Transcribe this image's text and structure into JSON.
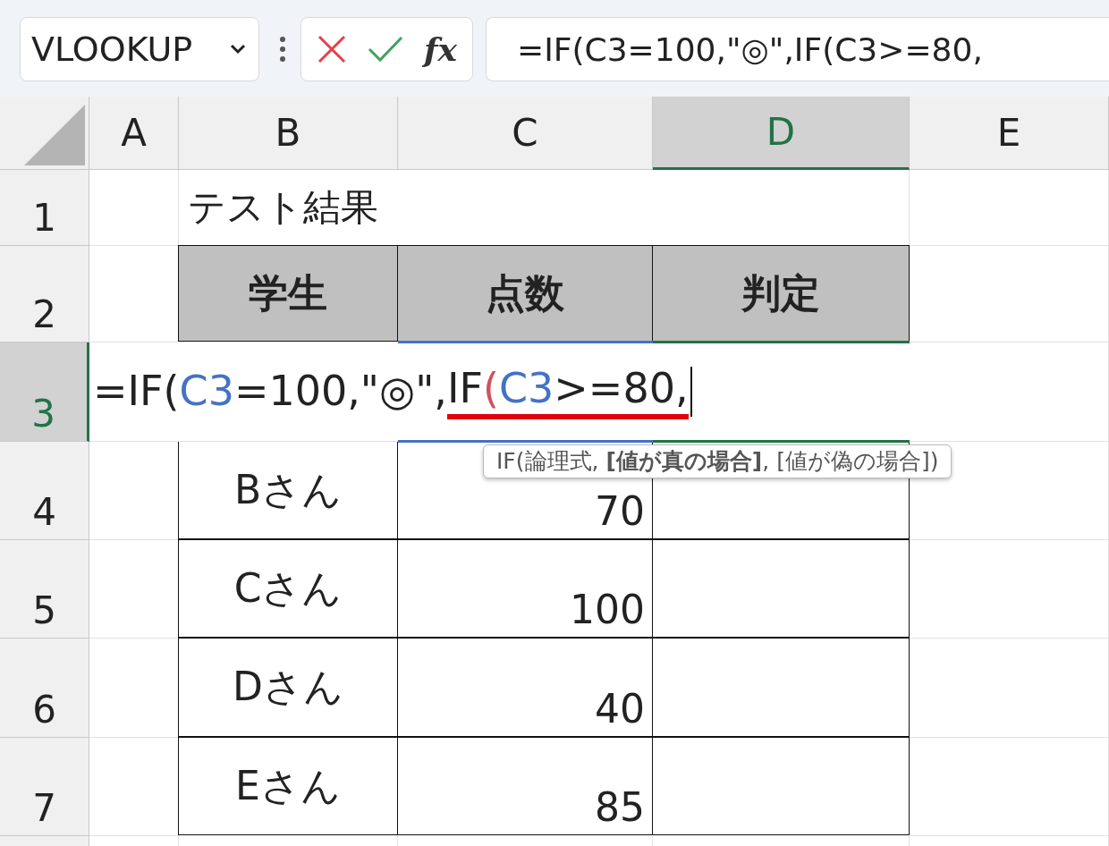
{
  "name_box": {
    "value": "VLOOKUP"
  },
  "formula_bar": {
    "fx_label": "fx",
    "value": "=IF(C3=100,\"◎\",IF(C3>=80,"
  },
  "columns": [
    {
      "label": "A",
      "selected": false
    },
    {
      "label": "B",
      "selected": false
    },
    {
      "label": "C",
      "selected": false
    },
    {
      "label": "D",
      "selected": true
    },
    {
      "label": "E",
      "selected": false
    }
  ],
  "rows": [
    {
      "label": "1",
      "selected": false,
      "kind": "title",
      "text": "テスト結果"
    },
    {
      "label": "2",
      "selected": false,
      "kind": "header",
      "cells": [
        "学生",
        "点数",
        "判定"
      ]
    },
    {
      "label": "3",
      "selected": true,
      "kind": "editing",
      "segments": [
        {
          "text": "=IF(",
          "kind": "plain",
          "underline": false
        },
        {
          "text": "C3",
          "kind": "ref",
          "underline": false
        },
        {
          "text": "=100,\"◎\",",
          "kind": "plain",
          "underline": false
        },
        {
          "text": "IF",
          "kind": "plain",
          "underline": true
        },
        {
          "text": "(",
          "kind": "paren",
          "underline": true
        },
        {
          "text": "C3",
          "kind": "ref",
          "underline": true
        },
        {
          "text": ">=80,",
          "kind": "plain",
          "underline": true
        }
      ]
    },
    {
      "label": "4",
      "selected": false,
      "kind": "data",
      "cells": [
        "Bさん",
        "70"
      ]
    },
    {
      "label": "5",
      "selected": false,
      "kind": "data",
      "cells": [
        "Cさん",
        "100"
      ]
    },
    {
      "label": "6",
      "selected": false,
      "kind": "data",
      "cells": [
        "Dさん",
        "40"
      ]
    },
    {
      "label": "7",
      "selected": false,
      "kind": "data",
      "cells": [
        "Eさん",
        "85"
      ]
    }
  ],
  "tooltip": {
    "text": "IF(論理式, **[値が真の場合]**, [値が偽の場合])"
  }
}
